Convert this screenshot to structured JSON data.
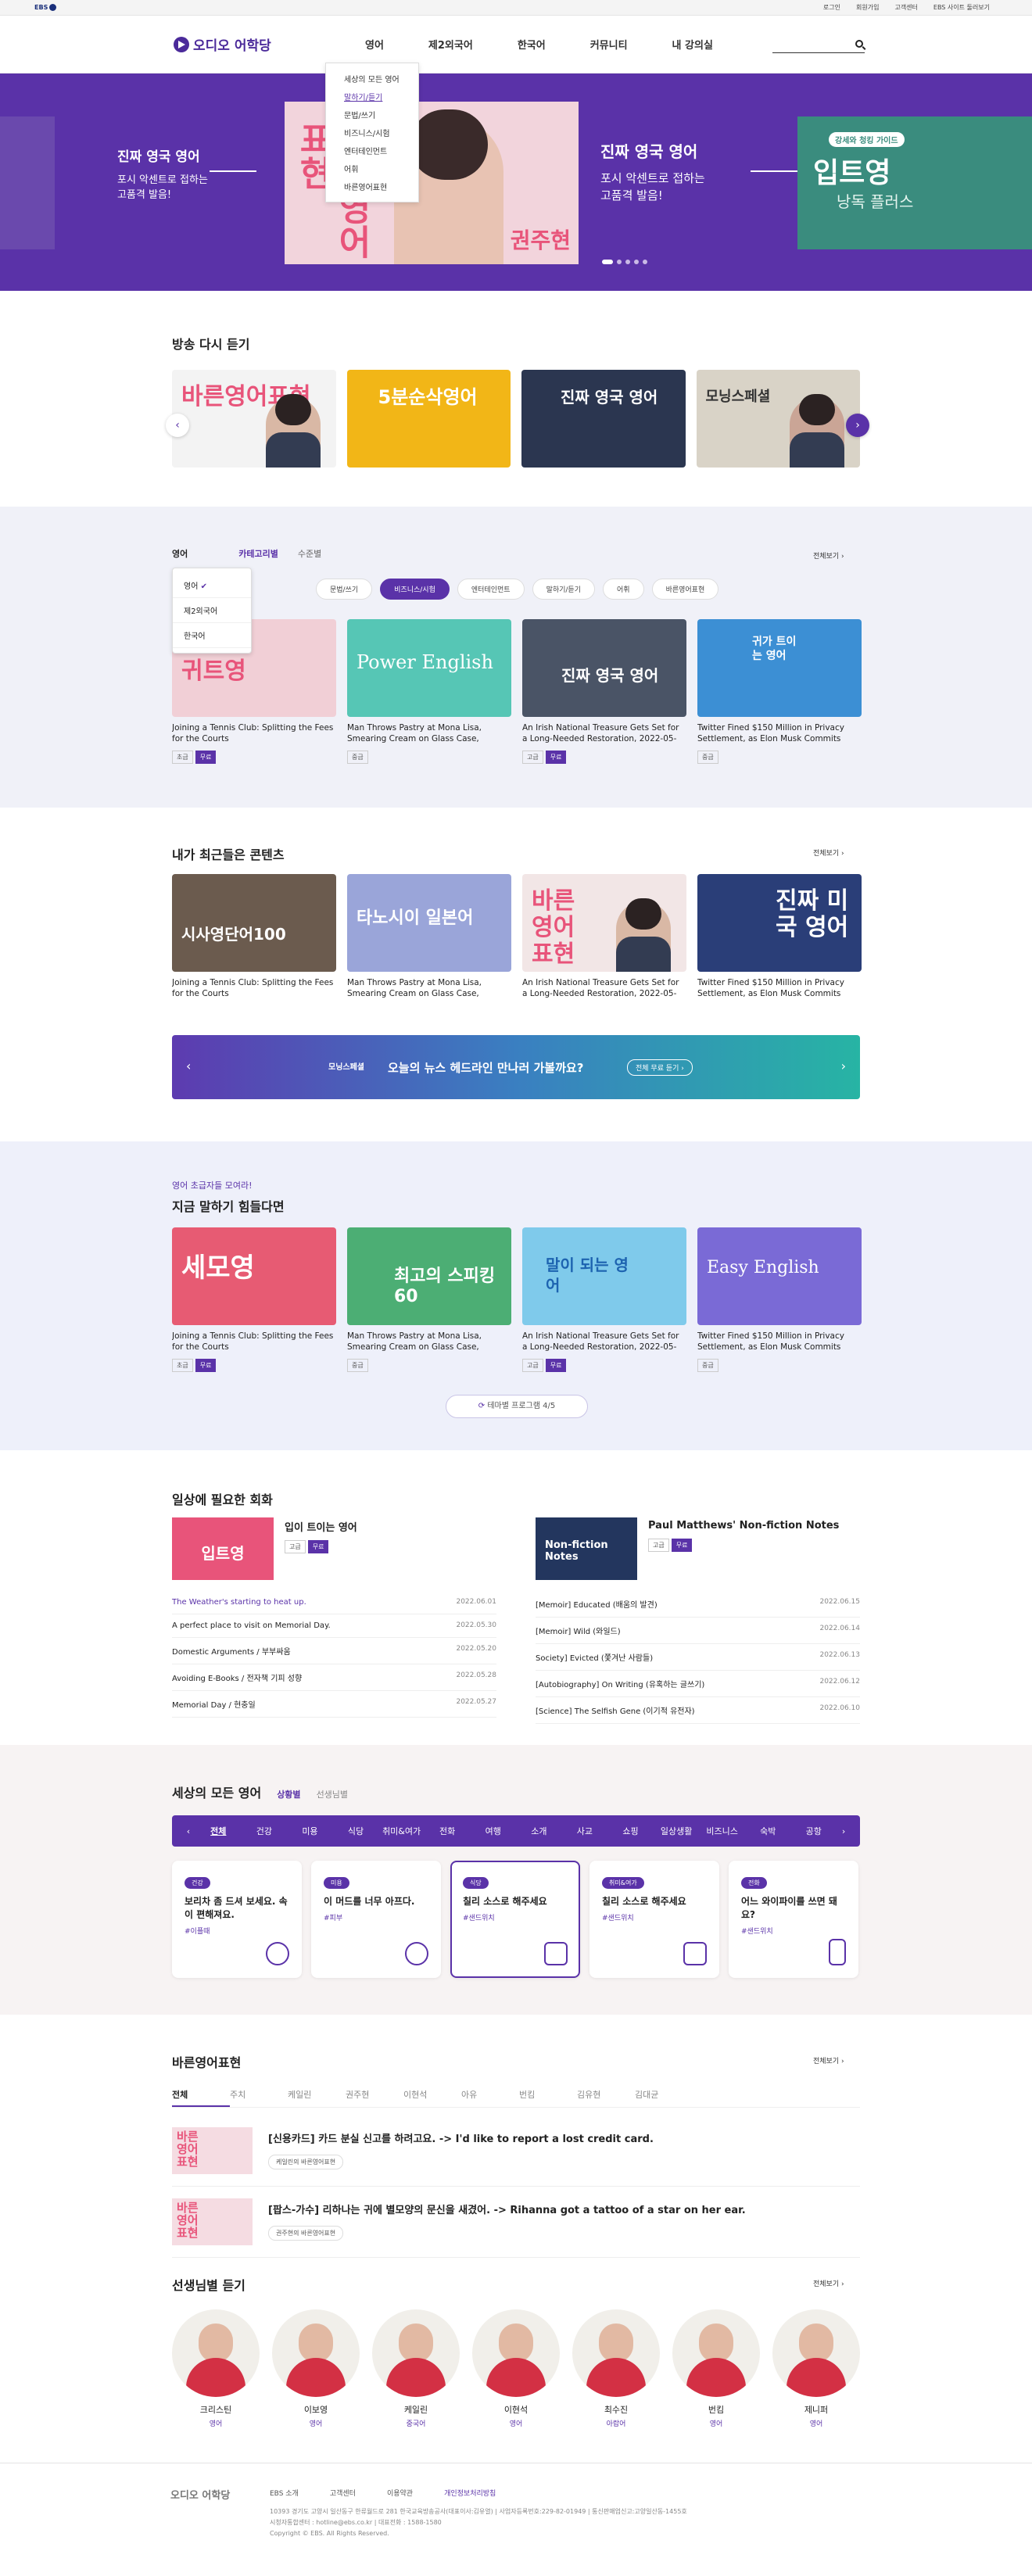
{
  "topbar": {
    "brand": "EBS",
    "links": [
      "로그인",
      "회원가입",
      "고객센터",
      "EBS 사이트 둘러보기"
    ]
  },
  "header": {
    "logo": "오디오 어학당",
    "menu": [
      "영어",
      "제2외국어",
      "한국어",
      "커뮤니티",
      "내 강의실"
    ],
    "search_placeholder": ""
  },
  "gnb_dropdown": [
    "세상의 모든 영어",
    "말하기/듣기",
    "문법/쓰기",
    "비즈니스/시험",
    "엔터테인먼트",
    "어휘",
    "바른영어표현"
  ],
  "hero": {
    "left_title": "진짜 영국 영어",
    "left_sub": "포시 악센트로 접하는 고품격 발음!",
    "card_big": "바른영어표현",
    "card_name": "권주현",
    "center_title": "진짜 영국 영어",
    "center_sub": "포시 악센트로 접하는 고품격 발음!",
    "right_tag": "강세와 청킹 가이드",
    "right_title": "입트영",
    "right_sub": "낭독 플러스"
  },
  "replay": {
    "title": "방송 다시 듣기",
    "items": [
      {
        "label": "바른영어표현"
      },
      {
        "label": "5분순삭영어"
      },
      {
        "label": "진짜 영국 영어"
      },
      {
        "label": "모닝스페셜"
      }
    ]
  },
  "category": {
    "more": "전체보기",
    "tabs": [
      "영어",
      "카테고리별",
      "수준별"
    ],
    "lang_options": [
      "영어",
      "제2외국어",
      "한국어"
    ],
    "pills": [
      "문법/쓰기",
      "비즈니스/시험",
      "엔터테인먼트",
      "말하기/듣기",
      "어휘",
      "바른영어표현"
    ],
    "cards": [
      {
        "label": "귀트영",
        "title": "Joining a Tennis Club: Splitting the Fees for the Courts",
        "tags": [
          "초급",
          "무료"
        ]
      },
      {
        "label": "Power English",
        "title": "Man Throws Pastry at Mona Lisa, Smearing Cream on Glass Case, 2022-...",
        "tags": [
          "중급"
        ]
      },
      {
        "label": "진짜 영국 영어",
        "title": "An Irish National Treasure Gets Set for a Long-Needed Restoration, 2022-05-30...",
        "tags": [
          "고급",
          "무료"
        ]
      },
      {
        "label": "귀가 트이는 영어",
        "title": "Twitter Fined $150 Million in Privacy Settlement, as Elon Musk Commits Mo...",
        "tags": [
          "중급"
        ]
      }
    ]
  },
  "recent": {
    "title": "내가 최근들은 콘텐츠",
    "more": "전체보기",
    "cards": [
      {
        "label": "시사영단어100",
        "title": "Joining a Tennis Club: Splitting the Fees for the Courts"
      },
      {
        "label": "타노시이 일본어",
        "title": "Man Throws Pastry at Mona Lisa, Smearing Cream on Glass Case, 2022-..."
      },
      {
        "label": "바른영어표현",
        "title": "An Irish National Treasure Gets Set for a Long-Needed Restoration, 2022-05-30..."
      },
      {
        "label": "진짜 미국 영어",
        "title": "Twitter Fined $150 Million in Privacy Settlement, as Elon Musk Commits Mo..."
      }
    ]
  },
  "banner": {
    "logo": "모닝스페셜",
    "text": "오늘의 뉴스 헤드라인 만나러 가볼까요?",
    "btn": "전체 무료 듣기"
  },
  "beginner": {
    "kicker": "영어 초급자들 모여라!",
    "title": "지금 말하기 힘들다면",
    "cards": [
      {
        "label": "세모영",
        "title": "Joining a Tennis Club: Splitting the Fees for the Courts",
        "tags": [
          "초급",
          "무료"
        ]
      },
      {
        "label": "최고의 스피킹60",
        "title": "Man Throws Pastry at Mona Lisa, Smearing Cream on Glass Case, 2022-...",
        "tags": [
          "중급"
        ]
      },
      {
        "label": "말이 되는 영어",
        "title": "An Irish National Treasure Gets Set for a Long-Needed Restoration, 2022-05-30...",
        "tags": [
          "고급",
          "무료"
        ]
      },
      {
        "label": "Easy English",
        "title": "Twitter Fined $150 Million in Privacy Settlement, as Elon Musk Commits Mo...",
        "tags": [
          "중급"
        ]
      }
    ],
    "pager": "테마별 프로그램 4/5"
  },
  "daily": {
    "title": "일상에 필요한 회화",
    "left": {
      "name": "입이 트이는 영어",
      "thumb": "입트영",
      "tags": [
        "고급",
        "무료"
      ],
      "rows": [
        {
          "t": "The Weather's starting to heat up.",
          "d": "2022.06.01"
        },
        {
          "t": "A perfect place to visit on Memorial Day.",
          "d": "2022.05.30"
        },
        {
          "t": "Domestic Arguments / 부부싸움",
          "d": "2022.05.20"
        },
        {
          "t": "Avoiding E-Books / 전자책 기피 성향",
          "d": "2022.05.28"
        },
        {
          "t": "Memorial Day / 현충일",
          "d": "2022.05.27"
        }
      ]
    },
    "right": {
      "name": "Paul Matthews' Non-fiction Notes",
      "thumb": "Non-fiction Notes",
      "tags": [
        "고급",
        "무료"
      ],
      "rows": [
        {
          "t": "[Memoir] Educated (배움의 발견)",
          "d": "2022.06.15"
        },
        {
          "t": "[Memoir] Wild (와일드)",
          "d": "2022.06.14"
        },
        {
          "t": "Society] Evicted (쫓겨난 사람들)",
          "d": "2022.06.13"
        },
        {
          "t": "[Autobiography] On Writing (유혹하는 글쓰기)",
          "d": "2022.06.12"
        },
        {
          "t": "[Science] The Selfish Gene (이기적 유전자)",
          "d": "2022.06.10"
        }
      ]
    }
  },
  "world": {
    "title": "세상의 모든 영어",
    "tabs": [
      "상황별",
      "선생님별"
    ],
    "cats": [
      "전체",
      "건강",
      "미용",
      "식당",
      "취미&여가",
      "전화",
      "여행",
      "소개",
      "사교",
      "쇼핑",
      "일상생활",
      "비즈니스",
      "숙박",
      "공항"
    ],
    "tips": [
      {
        "tag": "건강",
        "title": "보리차 좀 드셔 보세요. 속이 편해져요.",
        "hash": "#이플때"
      },
      {
        "tag": "미용",
        "title": "이 머드를 너무 아프다.",
        "hash": "#피부"
      },
      {
        "tag": "식당",
        "title": "칠리 소스로 해주세요",
        "hash": "#샌드위치"
      },
      {
        "tag": "취미&여가",
        "title": "칠리 소스로 해주세요",
        "hash": "#샌드위치"
      },
      {
        "tag": "전화",
        "title": "어느 와이파이를 쓰면 돼요?",
        "hash": "#샌드위치"
      }
    ]
  },
  "expr": {
    "title": "바른영어표현",
    "more": "전체보기",
    "tabs": [
      "전체",
      "주치",
      "케일린",
      "권주현",
      "이현석",
      "아유",
      "번킴",
      "김유현",
      "김대균"
    ],
    "items": [
      {
        "thumb": "바른영어표현",
        "text": "[신용카드] 카드 분실 신고를 하려고요. -> I'd like to report a lost credit card.",
        "badge": "케일린의 바른영어표현"
      },
      {
        "thumb": "바른영어표현",
        "text": "[팝스-가수] 리하나는 귀에 별모양의 문신을 새겼어. -> Rihanna got a tattoo of a star on her ear.",
        "badge": "권주현의 바른영어표현"
      }
    ]
  },
  "teachers": {
    "title": "선생님별 듣기",
    "more": "전체보기",
    "list": [
      {
        "n": "크리스틴",
        "r": "영어"
      },
      {
        "n": "이보영",
        "r": "영어"
      },
      {
        "n": "케일린",
        "r": "중국어"
      },
      {
        "n": "이현석",
        "r": "영어"
      },
      {
        "n": "최수진",
        "r": "아랍어"
      },
      {
        "n": "번킴",
        "r": "영어"
      },
      {
        "n": "제니퍼",
        "r": "영어"
      }
    ]
  },
  "footer": {
    "logo": "오디오 어학당",
    "links": [
      "EBS 소개",
      "고객센터",
      "이용약관",
      "개인정보처리방침"
    ],
    "info1": "10393 경기도 고양시 일산동구 한류월드로 281 한국교육방송공사(대표이사:김유열) | 사업자등록번호:229-82-01949 | 통신판매업신고:고양일산동-1455호",
    "info2": "시청자통합센터 : hotline@ebs.co.kr | 대표전화 : 1588-1580",
    "info3": "Copyright © EBS. All Rights Reserved."
  },
  "colors": {
    "brand": "#5a32a8",
    "accent": "#e8547a"
  }
}
